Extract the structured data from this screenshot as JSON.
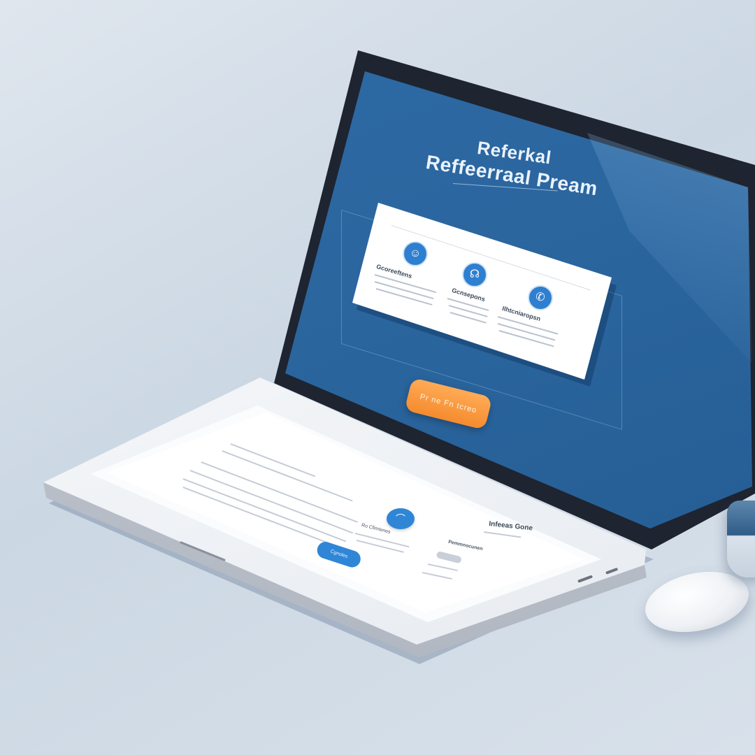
{
  "screen": {
    "title_line_1": "Referkal",
    "title_line_2": "Reffeerraal Pream",
    "steps": [
      {
        "icon": "contact-icon",
        "glyph": "☺",
        "label": "Gcoreeftens"
      },
      {
        "icon": "handshake-icon",
        "glyph": "☊",
        "label": "Gcnsepons"
      },
      {
        "icon": "reward-icon",
        "glyph": "✆",
        "label": "Ilhtcniaropsn"
      }
    ],
    "cta_label": "Pr ne Fn tcreo"
  },
  "deck": {
    "icon_glyph": "⌒",
    "step_label": "Ro Cfimtenes",
    "title": "Infeeas Gone",
    "subtitle": "Pemmnocunen",
    "button_label": "Cgnoles"
  },
  "colors": {
    "screen_blue": "#2b669f",
    "accent_blue": "#2f86d6",
    "cta_orange": "#f58b2e",
    "background": "#d8e1ea"
  }
}
